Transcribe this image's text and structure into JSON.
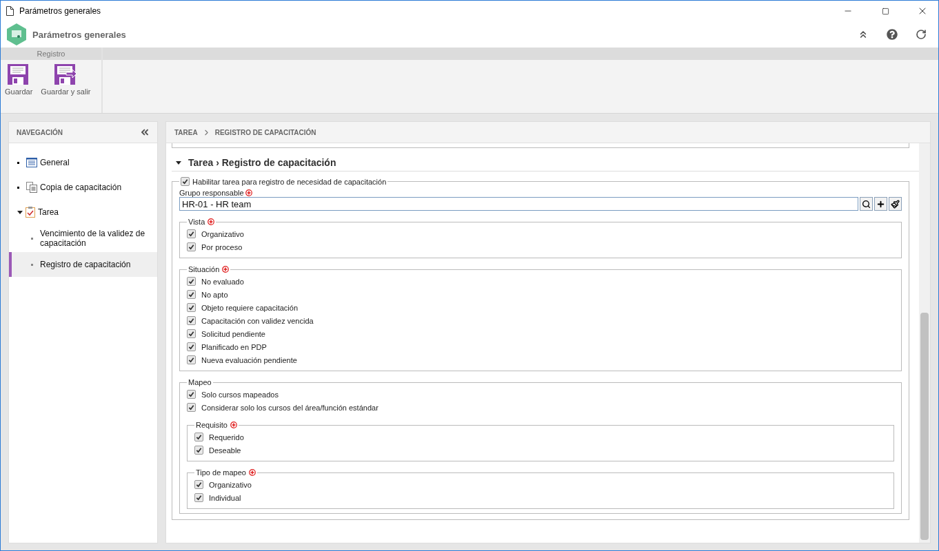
{
  "window": {
    "title": "Parámetros generales"
  },
  "header": {
    "title": "Parámetros generales"
  },
  "ribbon": {
    "group": "Registro",
    "buttons": [
      {
        "label": "Guardar",
        "kind": "save"
      },
      {
        "label": "Guardar y salir",
        "kind": "save-exit"
      }
    ]
  },
  "navigation": {
    "title": "NAVEGACIÓN",
    "items": [
      {
        "label": "General",
        "kind": "list",
        "selected": false
      },
      {
        "label": "Copia de capacitación",
        "kind": "copy",
        "selected": false
      },
      {
        "label": "Tarea",
        "kind": "task",
        "selected": false,
        "expanded": true,
        "children": [
          {
            "label": "Vencimiento de la validez de capacitación",
            "selected": false
          },
          {
            "label": "Registro de capacitación",
            "selected": true
          }
        ]
      }
    ]
  },
  "breadcrumb": [
    "TAREA",
    "REGISTRO DE CAPACITACIÓN"
  ],
  "section": {
    "title": "Tarea › Registro de capacitación",
    "expanded": true
  },
  "enable": {
    "label": "Habilitar tarea para registro de necesidad de capacitación",
    "checked": true
  },
  "group_field": {
    "label": "Grupo responsable",
    "required": true,
    "value": "HR-01 - HR team"
  },
  "fieldsets": [
    {
      "legend": "Vista",
      "required": true,
      "options": [
        {
          "label": "Organizativo",
          "checked": true
        },
        {
          "label": "Por proceso",
          "checked": true
        }
      ]
    },
    {
      "legend": "Situación",
      "required": true,
      "options": [
        {
          "label": "No evaluado",
          "checked": true
        },
        {
          "label": "No apto",
          "checked": true
        },
        {
          "label": "Objeto requiere capacitación",
          "checked": true
        },
        {
          "label": "Capacitación con validez vencida",
          "checked": true
        },
        {
          "label": "Solicitud pendiente",
          "checked": true
        },
        {
          "label": "Planificado en PDP",
          "checked": true
        },
        {
          "label": "Nueva evaluación pendiente",
          "checked": true
        }
      ]
    },
    {
      "legend": "Mapeo",
      "options": [
        {
          "label": "Solo cursos mapeados",
          "checked": true
        },
        {
          "label": "Considerar solo los cursos del área/función estándar",
          "checked": true
        }
      ],
      "groups": [
        {
          "legend": "Requisito",
          "required": true,
          "options": [
            {
              "label": "Requerido",
              "checked": true
            },
            {
              "label": "Deseable",
              "checked": true
            }
          ]
        },
        {
          "legend": "Tipo de mapeo",
          "required": true,
          "options": [
            {
              "label": "Organizativo",
              "checked": true
            },
            {
              "label": "Individual",
              "checked": true
            }
          ]
        }
      ]
    }
  ]
}
